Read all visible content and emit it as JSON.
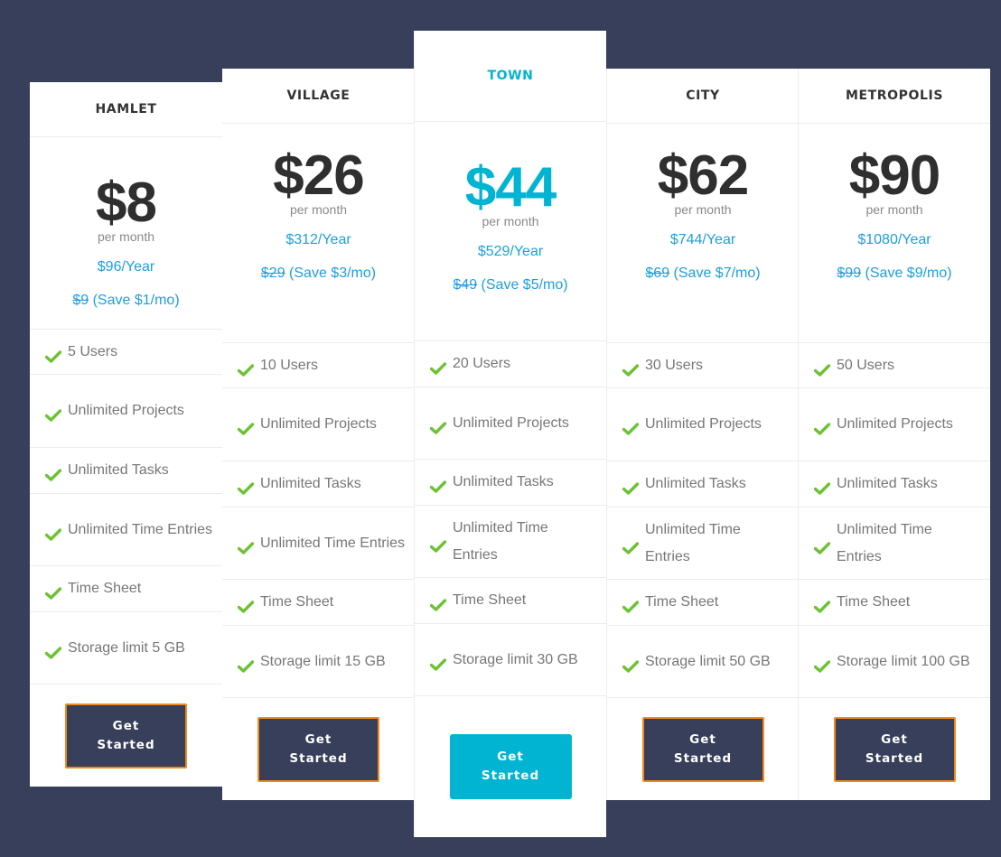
{
  "colors": {
    "background": "#373f5a",
    "accent": "#00b4d2",
    "link": "#1e9ee0",
    "check": "#6cc332",
    "button": "#373f5a",
    "button_border": "#f08a1c"
  },
  "plans": [
    {
      "name": "HAMLET",
      "price": "$8",
      "period": "per month",
      "yearly": "$96/Year",
      "old_price": "$9",
      "save": " (Save $1/mo)",
      "features": [
        "5 Users",
        "Unlimited Projects",
        "Unlimited Tasks",
        "Unlimited Time Entries",
        "Time Sheet",
        "Storage limit 5 GB"
      ],
      "cta": "Get Started",
      "featured": false
    },
    {
      "name": "VILLAGE",
      "price": "$26",
      "period": "per month",
      "yearly": "$312/Year",
      "old_price": "$29",
      "save": " (Save $3/mo)",
      "features": [
        "10 Users",
        "Unlimited Projects",
        "Unlimited Tasks",
        "Unlimited Time Entries",
        "Time Sheet",
        "Storage limit 15 GB"
      ],
      "cta": "Get Started",
      "featured": false
    },
    {
      "name": "TOWN",
      "price": "$44",
      "period": "per month",
      "yearly": "$529/Year",
      "old_price": "$49",
      "save": " (Save $5/mo)",
      "features": [
        "20 Users",
        "Unlimited Projects",
        "Unlimited Tasks",
        "Unlimited Time Entries",
        "Time Sheet",
        "Storage limit 30 GB"
      ],
      "cta": "Get Started",
      "featured": true
    },
    {
      "name": "CITY",
      "price": "$62",
      "period": "per month",
      "yearly": "$744/Year",
      "old_price": "$69",
      "save": " (Save $7/mo)",
      "features": [
        "30 Users",
        "Unlimited Projects",
        "Unlimited Tasks",
        "Unlimited Time Entries",
        "Time Sheet",
        "Storage limit 50 GB"
      ],
      "cta": "Get Started",
      "featured": false
    },
    {
      "name": "METROPOLIS",
      "price": "$90",
      "period": "per month",
      "yearly": "$1080/Year",
      "old_price": "$99",
      "save": " (Save $9/mo)",
      "features": [
        "50 Users",
        "Unlimited Projects",
        "Unlimited Tasks",
        "Unlimited Time Entries",
        "Time Sheet",
        "Storage limit 100 GB"
      ],
      "cta": "Get Started",
      "featured": false
    }
  ]
}
